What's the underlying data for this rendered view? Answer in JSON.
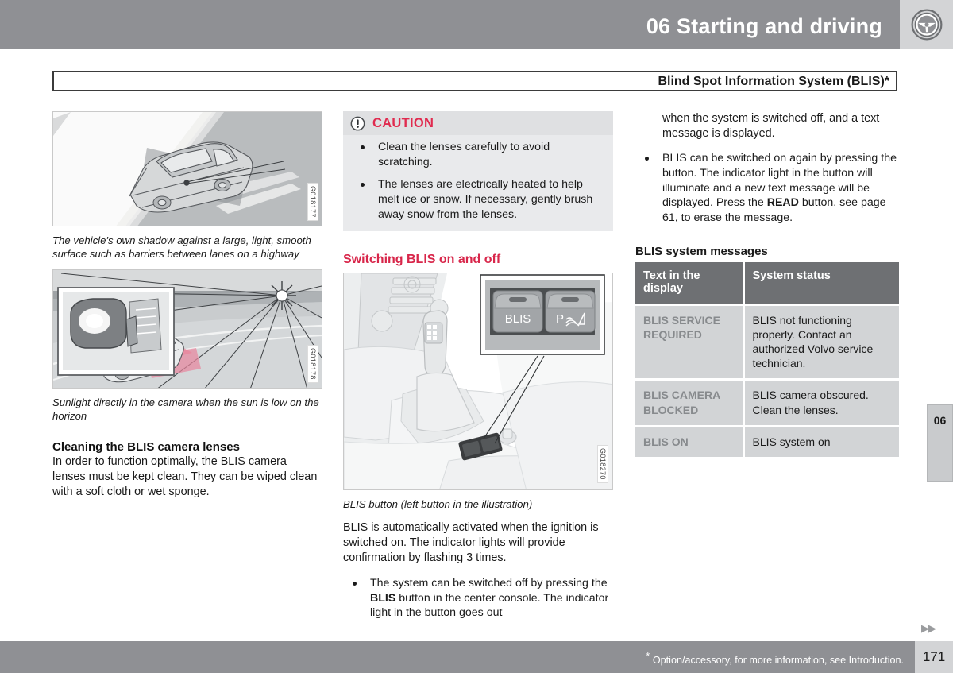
{
  "header": {
    "title": "06 Starting and driving",
    "icon": "steering-wheel-icon"
  },
  "section": {
    "title": "Blind Spot Information System (BLIS)*"
  },
  "left_column": {
    "figure1": {
      "id": "G018177",
      "alt": "Car on a highway casting its own shadow against a light barrier"
    },
    "caption1": "The vehicle's own shadow against a large, light, smooth surface such as barriers between lanes on a highway",
    "figure2": {
      "id": "G018178",
      "alt": "Car on a road with low sun shining directly into the camera, side mirror inset"
    },
    "caption2": "Sunlight directly in the camera when the sun is low on the horizon",
    "heading": "Cleaning the BLIS camera lenses",
    "paragraph": "In order to function optimally, the BLIS camera lenses must be kept clean. They can be wiped clean with a soft cloth or wet sponge."
  },
  "middle_column": {
    "caution": {
      "icon": "exclamation-circle-icon",
      "label": "CAUTION",
      "color": "#e02b4f",
      "items": [
        "Clean the lenses carefully to avoid scratching.",
        "The lenses are electrically heated to help melt ice or snow. If necessary, gently brush away snow from the lenses."
      ]
    },
    "heading": "Switching BLIS on and off",
    "figure3": {
      "id": "G018270",
      "alt": "Center console with gear shifter and BLIS button, callout detail of two buttons",
      "button_left_label": "BLIS",
      "button_right_label": "P",
      "button_right_icon": "park-assist-icon"
    },
    "caption3": "BLIS button (left button in the illustration)",
    "paragraph": "BLIS is automatically activated when the ignition is switched on. The indicator lights will provide confirmation by flashing 3 times.",
    "bullet1_part1": "The system can be switched off by pressing the ",
    "bullet1_bold": "BLIS",
    "bullet1_part2": " button in the center console. The indicator light in the button goes out"
  },
  "right_column": {
    "continuation": "when the system is switched off, and a text message is displayed.",
    "bullet_part1": "BLIS can be switched on again by pressing the button. The indicator light in the button will illuminate and a new text message will be displayed. Press the ",
    "bullet_bold": "READ",
    "bullet_part2": " button, see page 61, to erase the message.",
    "table": {
      "title": "BLIS system messages",
      "headers": [
        "Text in the display",
        "System status"
      ],
      "rows": [
        {
          "key": "BLIS SERVICE REQUIRED",
          "value": "BLIS not functioning properly. Contact an authorized Volvo service technician."
        },
        {
          "key": "BLIS CAMERA BLOCKED",
          "value": "BLIS camera obscured. Clean the lenses."
        },
        {
          "key": "BLIS ON",
          "value": "BLIS system on"
        }
      ]
    }
  },
  "chapter_tab": "06",
  "footer": {
    "arrows": "▶▶",
    "note_marker": "*",
    "note": " Option/accessory, for more information, see Introduction.",
    "page": "171"
  }
}
